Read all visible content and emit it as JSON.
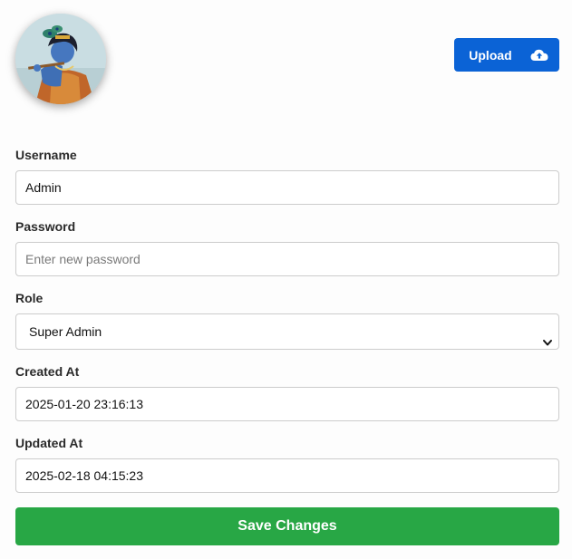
{
  "profile": {
    "avatar_alt": "Profile picture",
    "upload_label": "Upload",
    "upload_icon": "cloud-upload-icon"
  },
  "form": {
    "username": {
      "label": "Username",
      "value": "Admin"
    },
    "password": {
      "label": "Password",
      "value": "",
      "placeholder": "Enter new password"
    },
    "role": {
      "label": "Role",
      "value": "Super Admin"
    },
    "created_at": {
      "label": "Created At",
      "value": "2025-01-20 23:16:13"
    },
    "updated_at": {
      "label": "Updated At",
      "value": "2025-02-18 04:15:23"
    },
    "save_label": "Save Changes"
  },
  "colors": {
    "upload_button": "#0b63d6",
    "save_button": "#28a745",
    "input_border": "#cccccc"
  }
}
